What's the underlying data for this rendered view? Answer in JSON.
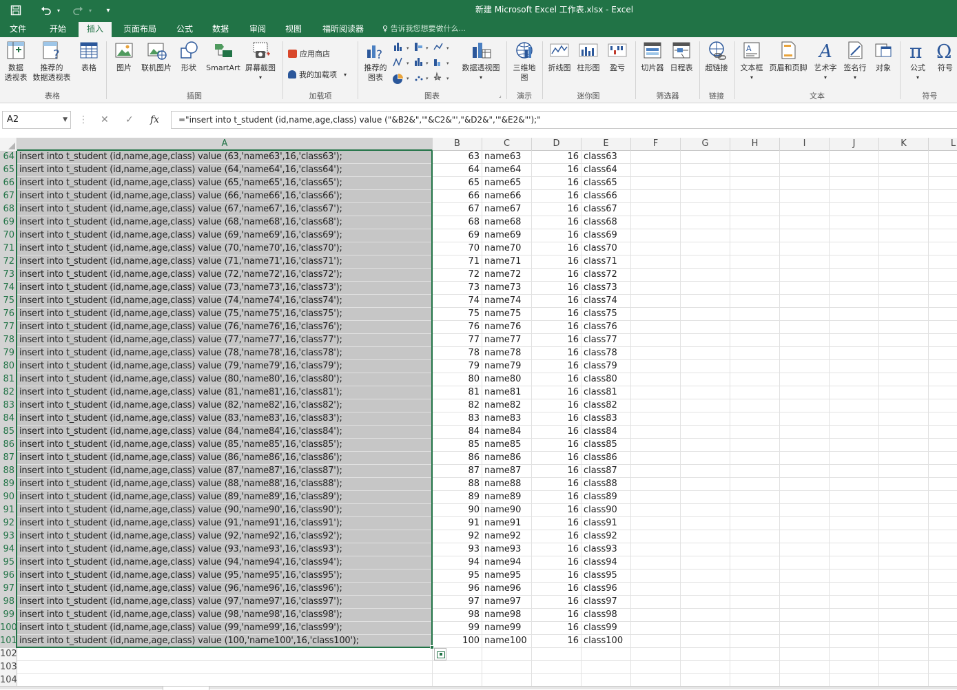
{
  "window": {
    "title": "新建 Microsoft Excel 工作表.xlsx - Excel"
  },
  "quick_access": {
    "save_icon": "save-icon",
    "undo_icon": "undo-icon",
    "redo_icon": "redo-icon",
    "customize_icon": "customize-icon"
  },
  "tabs": [
    {
      "label": "文件"
    },
    {
      "label": "开始"
    },
    {
      "label": "插入"
    },
    {
      "label": "页面布局"
    },
    {
      "label": "公式"
    },
    {
      "label": "数据"
    },
    {
      "label": "审阅"
    },
    {
      "label": "视图"
    },
    {
      "label": "福昕阅读器"
    }
  ],
  "tell_me": "告诉我您想要做什么...",
  "ribbon": {
    "buttons": [
      {
        "label": "数据\n透视表"
      },
      {
        "label": "推荐的\n数据透视表"
      },
      {
        "label": "表格"
      },
      {
        "label": "图片"
      },
      {
        "label": "联机图片"
      },
      {
        "label": "形状"
      },
      {
        "label": "SmartArt"
      },
      {
        "label": "屏幕截图"
      },
      {
        "label": "推荐的\n图表"
      },
      {
        "label": "数据透视图"
      },
      {
        "label": "三维地\n图"
      },
      {
        "label": "折线图"
      },
      {
        "label": "柱形图"
      },
      {
        "label": "盈亏"
      },
      {
        "label": "切片器"
      },
      {
        "label": "日程表"
      },
      {
        "label": "超链接"
      },
      {
        "label": "文本框"
      },
      {
        "label": "页眉和页脚"
      },
      {
        "label": "艺术字"
      },
      {
        "label": "签名行"
      },
      {
        "label": "对象"
      },
      {
        "label": "公式"
      },
      {
        "label": "符号"
      }
    ],
    "addins": {
      "store": "应用商店",
      "my_addins": "我的加载项"
    },
    "groups": [
      "表格",
      "插图",
      "加载项",
      "图表",
      "演示",
      "迷你图",
      "筛选器",
      "链接",
      "文本",
      "符号"
    ]
  },
  "formula_bar": {
    "name_box": "A2",
    "formula": "=\"insert into t_student (id,name,age,class) value (\"&B2&\",'\"&C2&\"',\"&D2&\",'\"&E2&\"');\""
  },
  "columns": [
    "A",
    "B",
    "C",
    "D",
    "E",
    "F",
    "G",
    "H",
    "I",
    "J",
    "K",
    "L"
  ],
  "rows": [
    {
      "n": "64",
      "a": "insert into t_student (id,name,age,class) value (63,'name63',16,'class63');",
      "b": "63",
      "c": "name63",
      "d": "16",
      "e": "class63"
    },
    {
      "n": "65",
      "a": "insert into t_student (id,name,age,class) value (64,'name64',16,'class64');",
      "b": "64",
      "c": "name64",
      "d": "16",
      "e": "class64"
    },
    {
      "n": "66",
      "a": "insert into t_student (id,name,age,class) value (65,'name65',16,'class65');",
      "b": "65",
      "c": "name65",
      "d": "16",
      "e": "class65"
    },
    {
      "n": "67",
      "a": "insert into t_student (id,name,age,class) value (66,'name66',16,'class66');",
      "b": "66",
      "c": "name66",
      "d": "16",
      "e": "class66"
    },
    {
      "n": "68",
      "a": "insert into t_student (id,name,age,class) value (67,'name67',16,'class67');",
      "b": "67",
      "c": "name67",
      "d": "16",
      "e": "class67"
    },
    {
      "n": "69",
      "a": "insert into t_student (id,name,age,class) value (68,'name68',16,'class68');",
      "b": "68",
      "c": "name68",
      "d": "16",
      "e": "class68"
    },
    {
      "n": "70",
      "a": "insert into t_student (id,name,age,class) value (69,'name69',16,'class69');",
      "b": "69",
      "c": "name69",
      "d": "16",
      "e": "class69"
    },
    {
      "n": "71",
      "a": "insert into t_student (id,name,age,class) value (70,'name70',16,'class70');",
      "b": "70",
      "c": "name70",
      "d": "16",
      "e": "class70"
    },
    {
      "n": "72",
      "a": "insert into t_student (id,name,age,class) value (71,'name71',16,'class71');",
      "b": "71",
      "c": "name71",
      "d": "16",
      "e": "class71"
    },
    {
      "n": "73",
      "a": "insert into t_student (id,name,age,class) value (72,'name72',16,'class72');",
      "b": "72",
      "c": "name72",
      "d": "16",
      "e": "class72"
    },
    {
      "n": "74",
      "a": "insert into t_student (id,name,age,class) value (73,'name73',16,'class73');",
      "b": "73",
      "c": "name73",
      "d": "16",
      "e": "class73"
    },
    {
      "n": "75",
      "a": "insert into t_student (id,name,age,class) value (74,'name74',16,'class74');",
      "b": "74",
      "c": "name74",
      "d": "16",
      "e": "class74"
    },
    {
      "n": "76",
      "a": "insert into t_student (id,name,age,class) value (75,'name75',16,'class75');",
      "b": "75",
      "c": "name75",
      "d": "16",
      "e": "class75"
    },
    {
      "n": "77",
      "a": "insert into t_student (id,name,age,class) value (76,'name76',16,'class76');",
      "b": "76",
      "c": "name76",
      "d": "16",
      "e": "class76"
    },
    {
      "n": "78",
      "a": "insert into t_student (id,name,age,class) value (77,'name77',16,'class77');",
      "b": "77",
      "c": "name77",
      "d": "16",
      "e": "class77"
    },
    {
      "n": "79",
      "a": "insert into t_student (id,name,age,class) value (78,'name78',16,'class78');",
      "b": "78",
      "c": "name78",
      "d": "16",
      "e": "class78"
    },
    {
      "n": "80",
      "a": "insert into t_student (id,name,age,class) value (79,'name79',16,'class79');",
      "b": "79",
      "c": "name79",
      "d": "16",
      "e": "class79"
    },
    {
      "n": "81",
      "a": "insert into t_student (id,name,age,class) value (80,'name80',16,'class80');",
      "b": "80",
      "c": "name80",
      "d": "16",
      "e": "class80"
    },
    {
      "n": "82",
      "a": "insert into t_student (id,name,age,class) value (81,'name81',16,'class81');",
      "b": "81",
      "c": "name81",
      "d": "16",
      "e": "class81"
    },
    {
      "n": "83",
      "a": "insert into t_student (id,name,age,class) value (82,'name82',16,'class82');",
      "b": "82",
      "c": "name82",
      "d": "16",
      "e": "class82"
    },
    {
      "n": "84",
      "a": "insert into t_student (id,name,age,class) value (83,'name83',16,'class83');",
      "b": "83",
      "c": "name83",
      "d": "16",
      "e": "class83"
    },
    {
      "n": "85",
      "a": "insert into t_student (id,name,age,class) value (84,'name84',16,'class84');",
      "b": "84",
      "c": "name84",
      "d": "16",
      "e": "class84"
    },
    {
      "n": "86",
      "a": "insert into t_student (id,name,age,class) value (85,'name85',16,'class85');",
      "b": "85",
      "c": "name85",
      "d": "16",
      "e": "class85"
    },
    {
      "n": "87",
      "a": "insert into t_student (id,name,age,class) value (86,'name86',16,'class86');",
      "b": "86",
      "c": "name86",
      "d": "16",
      "e": "class86"
    },
    {
      "n": "88",
      "a": "insert into t_student (id,name,age,class) value (87,'name87',16,'class87');",
      "b": "87",
      "c": "name87",
      "d": "16",
      "e": "class87"
    },
    {
      "n": "89",
      "a": "insert into t_student (id,name,age,class) value (88,'name88',16,'class88');",
      "b": "88",
      "c": "name88",
      "d": "16",
      "e": "class88"
    },
    {
      "n": "90",
      "a": "insert into t_student (id,name,age,class) value (89,'name89',16,'class89');",
      "b": "89",
      "c": "name89",
      "d": "16",
      "e": "class89"
    },
    {
      "n": "91",
      "a": "insert into t_student (id,name,age,class) value (90,'name90',16,'class90');",
      "b": "90",
      "c": "name90",
      "d": "16",
      "e": "class90"
    },
    {
      "n": "92",
      "a": "insert into t_student (id,name,age,class) value (91,'name91',16,'class91');",
      "b": "91",
      "c": "name91",
      "d": "16",
      "e": "class91"
    },
    {
      "n": "93",
      "a": "insert into t_student (id,name,age,class) value (92,'name92',16,'class92');",
      "b": "92",
      "c": "name92",
      "d": "16",
      "e": "class92"
    },
    {
      "n": "94",
      "a": "insert into t_student (id,name,age,class) value (93,'name93',16,'class93');",
      "b": "93",
      "c": "name93",
      "d": "16",
      "e": "class93"
    },
    {
      "n": "95",
      "a": "insert into t_student (id,name,age,class) value (94,'name94',16,'class94');",
      "b": "94",
      "c": "name94",
      "d": "16",
      "e": "class94"
    },
    {
      "n": "96",
      "a": "insert into t_student (id,name,age,class) value (95,'name95',16,'class95');",
      "b": "95",
      "c": "name95",
      "d": "16",
      "e": "class95"
    },
    {
      "n": "97",
      "a": "insert into t_student (id,name,age,class) value (96,'name96',16,'class96');",
      "b": "96",
      "c": "name96",
      "d": "16",
      "e": "class96"
    },
    {
      "n": "98",
      "a": "insert into t_student (id,name,age,class) value (97,'name97',16,'class97');",
      "b": "97",
      "c": "name97",
      "d": "16",
      "e": "class97"
    },
    {
      "n": "99",
      "a": "insert into t_student (id,name,age,class) value (98,'name98',16,'class98');",
      "b": "98",
      "c": "name98",
      "d": "16",
      "e": "class98"
    },
    {
      "n": "100",
      "a": "insert into t_student (id,name,age,class) value (99,'name99',16,'class99');",
      "b": "99",
      "c": "name99",
      "d": "16",
      "e": "class99"
    },
    {
      "n": "101",
      "a": "insert into t_student (id,name,age,class) value (100,'name100',16,'class100');",
      "b": "100",
      "c": "name100",
      "d": "16",
      "e": "class100"
    },
    {
      "n": "102",
      "a": "",
      "b": "",
      "c": "",
      "d": "",
      "e": ""
    },
    {
      "n": "103",
      "a": "",
      "b": "",
      "c": "",
      "d": "",
      "e": ""
    },
    {
      "n": "104",
      "a": "",
      "b": "",
      "c": "",
      "d": "",
      "e": ""
    }
  ],
  "selection": {
    "columns": [
      "A"
    ]
  },
  "colors": {
    "accent": "#217346",
    "selection_fill": "#c6c6c6"
  }
}
